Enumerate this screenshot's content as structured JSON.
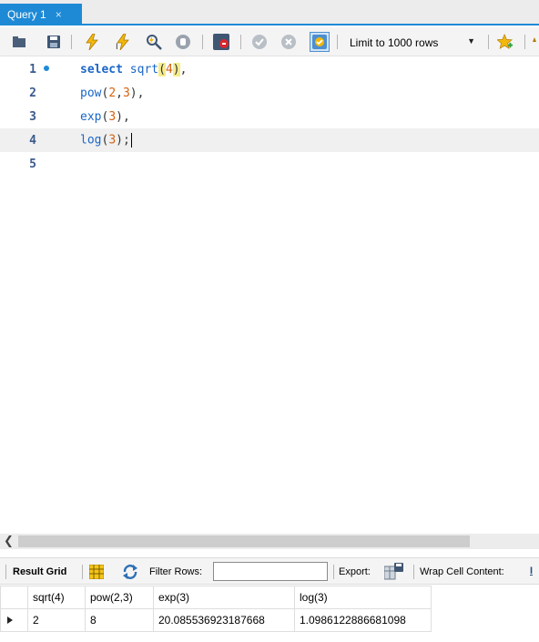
{
  "tab": {
    "title": "Query 1",
    "close_glyph": "×"
  },
  "toolbar": {
    "icons": [
      "open-folder-icon",
      "save-icon",
      "execute-icon",
      "execute-current-icon",
      "explain-icon",
      "stop-icon",
      "toggle-error-icon",
      "commit-icon",
      "rollback-icon",
      "autocommit-icon",
      "bookmark-icon"
    ],
    "limit_label": "Limit to 1000 rows"
  },
  "editor": {
    "lines": [
      {
        "number": "1",
        "has_marker": true
      },
      {
        "number": "2"
      },
      {
        "number": "3"
      },
      {
        "number": "4",
        "current": true
      },
      {
        "number": "5"
      }
    ],
    "code": {
      "l1_kw": "select",
      "l1_fn": "sqrt",
      "l1_open": "(",
      "l1_arg": "4",
      "l1_close": ")",
      "l1_tail": ",",
      "l2_fn": "pow",
      "l2_open": "(",
      "l2_a": "2",
      "l2_comma": ",",
      "l2_b": "3",
      "l2_close": "),",
      "l3_fn": "exp",
      "l3_open": "(",
      "l3_arg": "3",
      "l3_close": "),",
      "l4_fn": "log",
      "l4_open": "(",
      "l4_arg": "3",
      "l4_close": ");"
    }
  },
  "result_toolbar": {
    "result_grid_label": "Result Grid",
    "filter_label": "Filter Rows:",
    "filter_value": "",
    "export_label": "Export:",
    "wrap_label": "Wrap Cell Content:"
  },
  "grid": {
    "columns": [
      "sqrt(4)",
      "pow(2,3)",
      "exp(3)",
      "log(3)"
    ],
    "rows": [
      [
        "2",
        "8",
        "20.085536923187668",
        "1.0986122886681098"
      ]
    ]
  },
  "colors": {
    "accent": "#1e8ad6",
    "keyword": "#1a66c6",
    "number": "#d4620f",
    "bracket_highlight": "#f6ec8c"
  }
}
